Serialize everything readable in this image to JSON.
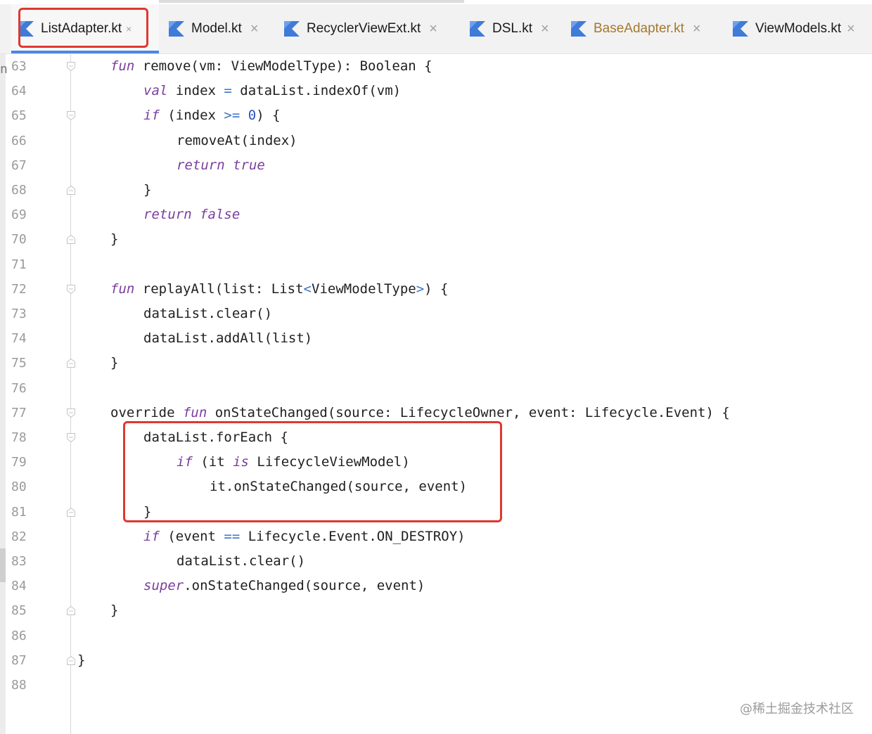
{
  "tabs": [
    {
      "label": "ListAdapter.kt",
      "close": "×",
      "active": true
    },
    {
      "label": "Model.kt",
      "close": "×"
    },
    {
      "label": "RecyclerViewExt.kt",
      "close": "×"
    },
    {
      "label": "DSL.kt",
      "close": "×"
    },
    {
      "label": "BaseAdapter.kt",
      "close": "×",
      "modified": true
    },
    {
      "label": "ViewModels.kt",
      "close": "×"
    }
  ],
  "colors": {
    "keyword": "#7a3e9d",
    "operator": "#3a74c9",
    "number": "#2a52be",
    "highlight_box": "#e0382f",
    "active_tab_underline": "#4c87e8",
    "modified_tab": "#a5782d"
  },
  "editor": {
    "left_cut_char": "n",
    "lines": [
      {
        "no": "63",
        "fold": "open",
        "indent": 1,
        "tokens": [
          [
            "kw",
            "fun"
          ],
          [
            "t",
            " remove(vm: ViewModelType): Boolean {"
          ]
        ]
      },
      {
        "no": "64",
        "indent": 2,
        "tokens": [
          [
            "kw",
            "val"
          ],
          [
            "t",
            " index "
          ],
          [
            "op",
            "="
          ],
          [
            "t",
            " dataList.indexOf(vm)"
          ]
        ]
      },
      {
        "no": "65",
        "fold": "open",
        "indent": 2,
        "tokens": [
          [
            "kw",
            "if"
          ],
          [
            "t",
            " (index "
          ],
          [
            "op",
            ">="
          ],
          [
            "t",
            " "
          ],
          [
            "num",
            "0"
          ],
          [
            "t",
            ") {"
          ]
        ]
      },
      {
        "no": "66",
        "indent": 3,
        "tokens": [
          [
            "t",
            "removeAt(index)"
          ]
        ]
      },
      {
        "no": "67",
        "indent": 3,
        "tokens": [
          [
            "kw",
            "return true"
          ]
        ]
      },
      {
        "no": "68",
        "fold": "close",
        "indent": 2,
        "tokens": [
          [
            "t",
            "}"
          ]
        ]
      },
      {
        "no": "69",
        "indent": 2,
        "tokens": [
          [
            "kw",
            "return false"
          ]
        ]
      },
      {
        "no": "70",
        "fold": "close",
        "indent": 1,
        "tokens": [
          [
            "t",
            "}"
          ]
        ]
      },
      {
        "no": "71",
        "indent": 0,
        "tokens": []
      },
      {
        "no": "72",
        "fold": "open",
        "indent": 1,
        "tokens": [
          [
            "kw",
            "fun"
          ],
          [
            "t",
            " replayAll(list: List"
          ],
          [
            "op",
            "<"
          ],
          [
            "t",
            "ViewModelType"
          ],
          [
            "op",
            ">"
          ],
          [
            "t",
            ") {"
          ]
        ]
      },
      {
        "no": "73",
        "indent": 2,
        "tokens": [
          [
            "t",
            "dataList.clear()"
          ]
        ]
      },
      {
        "no": "74",
        "indent": 2,
        "tokens": [
          [
            "t",
            "dataList.addAll(list)"
          ]
        ]
      },
      {
        "no": "75",
        "fold": "close",
        "indent": 1,
        "tokens": [
          [
            "t",
            "}"
          ]
        ]
      },
      {
        "no": "76",
        "indent": 0,
        "tokens": []
      },
      {
        "no": "77",
        "fold": "open",
        "indent": 1,
        "tokens": [
          [
            "t",
            "override "
          ],
          [
            "kw",
            "fun"
          ],
          [
            "t",
            " onStateChanged(source: LifecycleOwner, event: Lifecycle.Event) {"
          ]
        ]
      },
      {
        "no": "78",
        "fold": "open",
        "indent": 2,
        "tokens": [
          [
            "t",
            "dataList.forEach {"
          ]
        ]
      },
      {
        "no": "79",
        "indent": 3,
        "tokens": [
          [
            "kw",
            "if"
          ],
          [
            "t",
            " (it "
          ],
          [
            "kw",
            "is"
          ],
          [
            "t",
            " LifecycleViewModel)"
          ]
        ]
      },
      {
        "no": "80",
        "indent": 4,
        "tokens": [
          [
            "t",
            "it.onStateChanged(source, event)"
          ]
        ]
      },
      {
        "no": "81",
        "fold": "close",
        "indent": 2,
        "tokens": [
          [
            "t",
            "}"
          ]
        ]
      },
      {
        "no": "82",
        "indent": 2,
        "tokens": [
          [
            "kw",
            "if"
          ],
          [
            "t",
            " (event "
          ],
          [
            "op",
            "=="
          ],
          [
            "t",
            " Lifecycle.Event.ON_DESTROY)"
          ]
        ]
      },
      {
        "no": "83",
        "indent": 3,
        "tokens": [
          [
            "t",
            "dataList.clear()"
          ]
        ]
      },
      {
        "no": "84",
        "indent": 2,
        "tokens": [
          [
            "kw",
            "super"
          ],
          [
            "t",
            ".onStateChanged(source, event)"
          ]
        ]
      },
      {
        "no": "85",
        "fold": "close",
        "indent": 1,
        "tokens": [
          [
            "t",
            "}"
          ]
        ]
      },
      {
        "no": "86",
        "indent": 0,
        "tokens": []
      },
      {
        "no": "87",
        "fold": "close",
        "indent": 0,
        "tokens": [
          [
            "t",
            "}"
          ]
        ]
      },
      {
        "no": "88",
        "indent": 0,
        "tokens": []
      }
    ]
  },
  "watermark": "@稀土掘金技术社区"
}
